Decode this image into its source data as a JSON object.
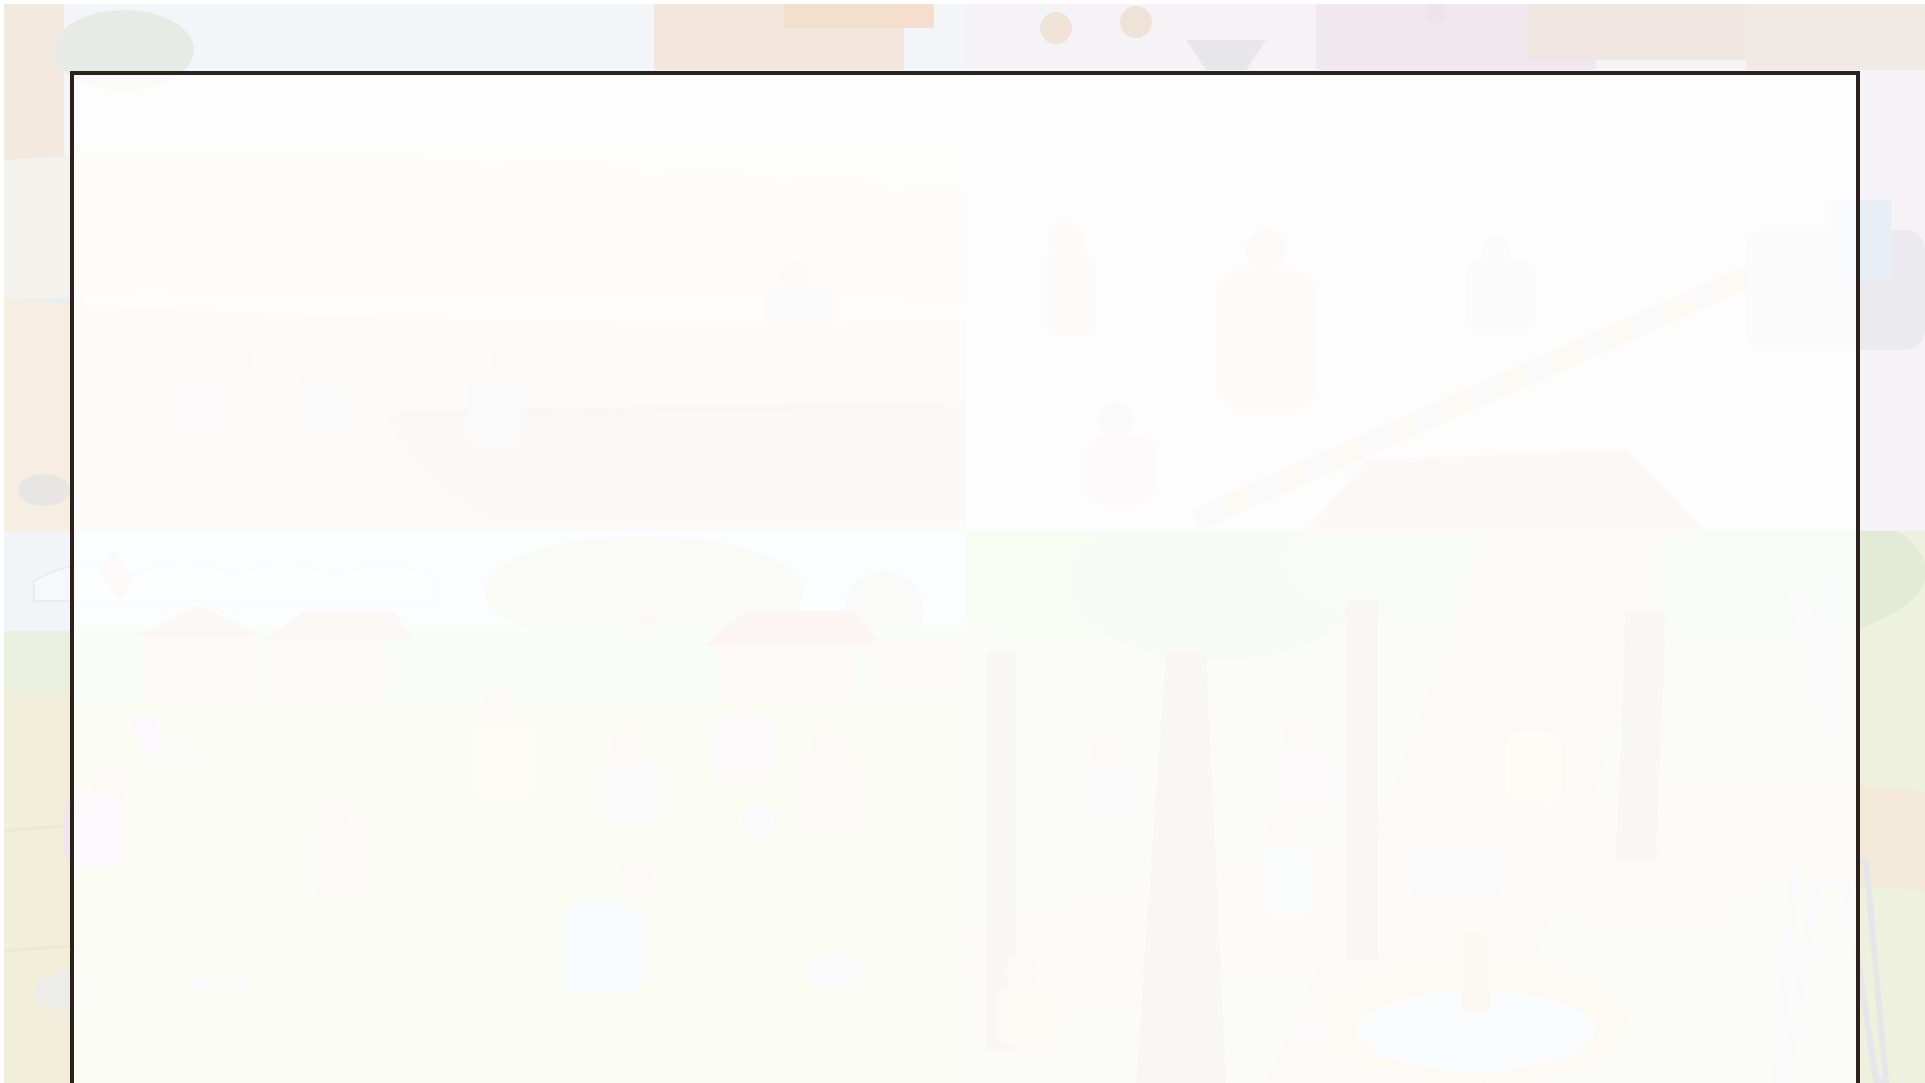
{
  "slide": {
    "background_scenes": [
      {
        "name": "riverbank-scene",
        "position": "top-left"
      },
      {
        "name": "street-scene",
        "position": "top-right"
      },
      {
        "name": "playground-field-scene",
        "position": "bottom-left"
      },
      {
        "name": "park-garden-scene",
        "position": "bottom-right"
      }
    ],
    "panel": {
      "border_color": "#2d211c",
      "fill_color": "#ffffff"
    }
  }
}
